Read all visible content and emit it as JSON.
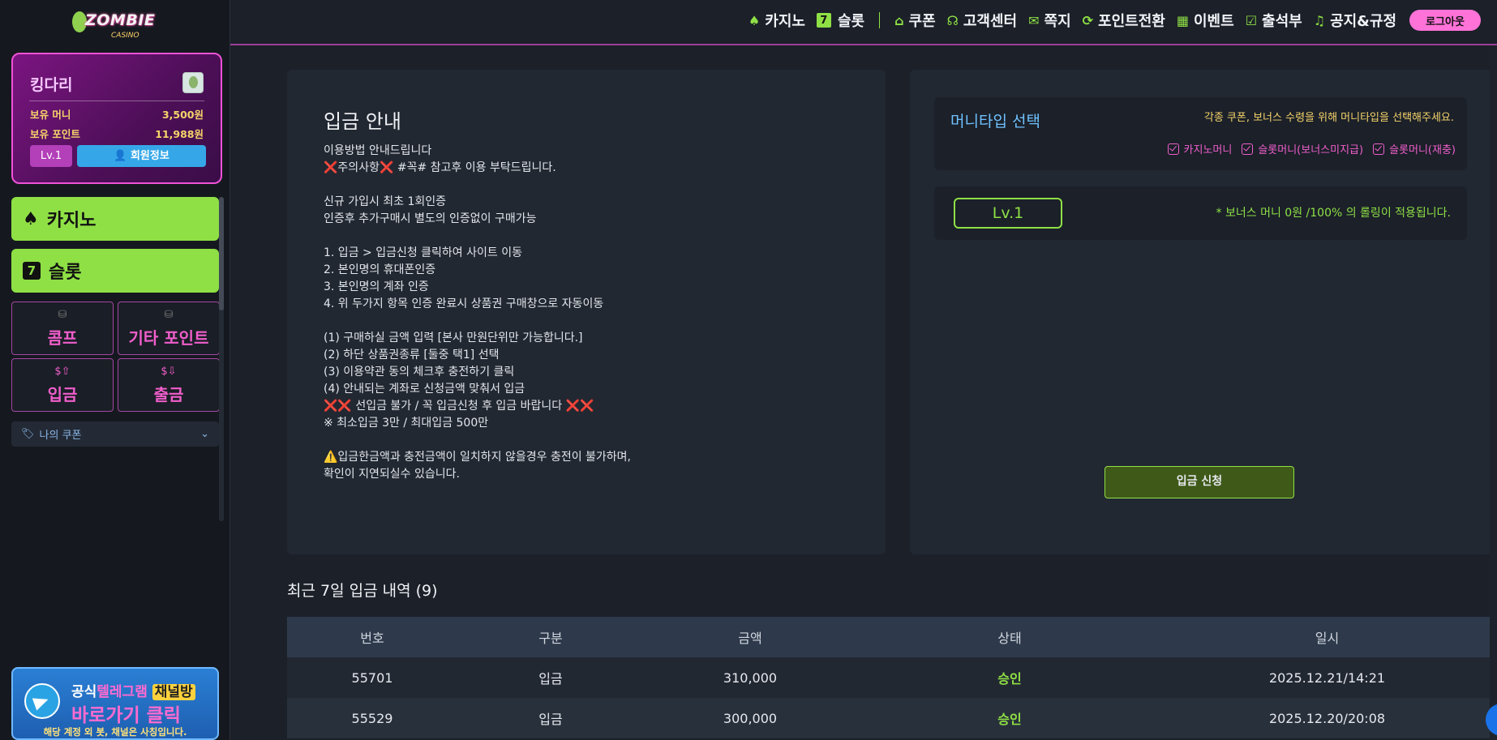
{
  "brand": {
    "logo_text": "ZOMBIE",
    "logo_sub": "CASINO"
  },
  "profile": {
    "name": "킹다리",
    "money_label": "보유 머니",
    "money_value": "3,500원",
    "points_label": "보유 포인트",
    "points_value": "11,988원",
    "level": "Lv.1",
    "member_info": "회원정보"
  },
  "sidebar": {
    "casino": "카지노",
    "slot": "슬롯",
    "tiles": [
      {
        "icon": "coins-icon",
        "label": "콤프"
      },
      {
        "icon": "coins-icon",
        "label": "기타 포인트"
      },
      {
        "icon": "deposit-icon",
        "label": "입금"
      },
      {
        "icon": "withdraw-icon",
        "label": "출금"
      }
    ],
    "coupon": "나의 쿠폰",
    "telegram": {
      "line1_a": "공식",
      "line1_b": "텔레그램",
      "line1_c": "채널방",
      "line2": "바로가기 클릭",
      "line3": "해당 계정 외 봇, 채널은 사칭입니다."
    }
  },
  "topnav": {
    "items": [
      {
        "label": "카지노",
        "icon": "spade-icon"
      },
      {
        "label": "슬롯",
        "icon": "seven-icon"
      },
      {
        "label": "쿠폰",
        "icon": "tag-icon"
      },
      {
        "label": "고객센터",
        "icon": "headset-icon"
      },
      {
        "label": "쪽지",
        "icon": "mail-icon"
      },
      {
        "label": "포인트전환",
        "icon": "refresh-icon"
      },
      {
        "label": "이벤트",
        "icon": "calendar-icon"
      },
      {
        "label": "출석부",
        "icon": "check-icon"
      },
      {
        "label": "공지&규정",
        "icon": "bell-icon"
      }
    ],
    "logout": "로그아웃"
  },
  "guide": {
    "title": "입금 안내",
    "body": "이용방법 안내드립니다\n❌주의사항❌ #꼭# 참고후 이용 부탁드립니다.\n\n신규 가입시 최초 1회인증\n인증후 추가구매시 별도의 인증없이 구매가능\n\n1. 입금 > 입금신청 클릭하여 사이트 이동\n2. 본인명의 휴대폰인증\n3. 본인명의 계좌 인증\n4. 위 두가지 항목 인증 완료시 상품권 구매창으로 자동이동\n\n(1) 구매하실 금액 입력 [본사 만원단위만 가능합니다.]\n(2) 하단 상품권종류 [둘중 택1] 선택\n(3) 이용약관 동의 체크후 충전하기 클릭\n(4) 안내되는 계좌로 신청금액 맞춰서 입금\n❌❌ 선입금 불가 / 꼭 입금신청 후 입금 바랍니다 ❌❌\n※ 최소입금 3만 / 최대입금 500만\n\n⚠️입금한금액과 충전금액이 일치하지 않을경우 충전이 불가하며,\n확인이 지연되실수 있습니다."
  },
  "money_type": {
    "title": "머니타입 선택",
    "hint": "각종 쿠폰, 보너스 수령을 위해 머니타입을 선택해주세요.",
    "options": [
      "카지노머니",
      "슬롯머니(보너스미지급)",
      "슬롯머니(재충)"
    ]
  },
  "level_box": {
    "level": "Lv.1",
    "note": "* 보너스 머니 0원 /100% 의 롤링이 적용됩니다."
  },
  "apply_button": "입금 신청",
  "history": {
    "title": "최근 7일 입금 내역 (9)",
    "columns": [
      "번호",
      "구분",
      "금액",
      "상태",
      "일시"
    ],
    "rows": [
      [
        "55701",
        "입금",
        "310,000",
        "승인",
        "2025.12.21/14:21"
      ],
      [
        "55529",
        "입금",
        "300,000",
        "승인",
        "2025.12.20/20:08"
      ]
    ]
  },
  "colors": {
    "accent_green": "#8fe045",
    "accent_pink": "#f05ecb",
    "accent_blue": "#6fc2ff"
  }
}
